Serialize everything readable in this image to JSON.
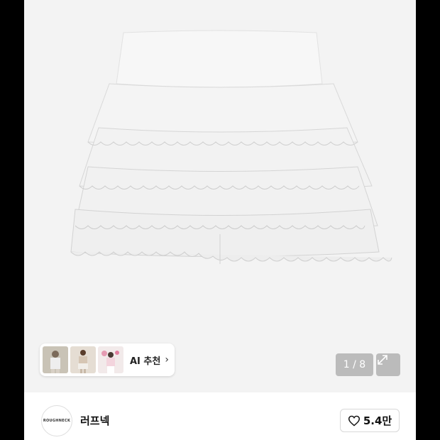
{
  "gallery": {
    "page_indicator": "1 / 8",
    "expand_icon": "expand-arrows-icon",
    "ai_recommend_label": "AI 추천",
    "ai_recommend_chevron": "›",
    "thumbnails": [
      "thumbnail-1",
      "thumbnail-2",
      "thumbnail-3"
    ]
  },
  "store": {
    "logo_text": "ROUGHNECK",
    "name": "러프넥",
    "like_icon": "heart-outline-icon",
    "like_count": "5.4만"
  },
  "colors": {
    "image_background": "#f3f3f3",
    "overlay_gray": "#787878",
    "outer_background": "#000000"
  }
}
